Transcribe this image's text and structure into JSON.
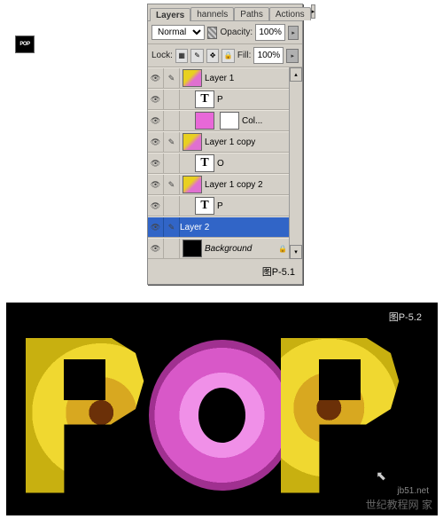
{
  "tabs": {
    "layers": "Layers",
    "channels": "hannels",
    "paths": "Paths",
    "actions": "Actions"
  },
  "blend": {
    "mode": "Normal",
    "opacity_label": "Opacity:",
    "opacity": "100%"
  },
  "lock": {
    "label": "Lock:",
    "fill_label": "Fill:",
    "fill": "100%"
  },
  "layers": {
    "l0": {
      "name": "Layer 1",
      "type": "P"
    },
    "l1": {
      "name": "P"
    },
    "l2": {
      "name": "Col..."
    },
    "l3": {
      "name": "Layer 1 copy",
      "type": "O"
    },
    "l4": {
      "name": "O"
    },
    "l5": {
      "name": "Layer 1 copy 2",
      "type": "P"
    },
    "l6": {
      "name": "P"
    },
    "l7": {
      "name": "Layer 2"
    },
    "l8": {
      "name": "Background"
    }
  },
  "figure1": "图P-5.1",
  "figure2": "图P-5.2",
  "watermark1": "jb51.net",
  "watermark2": "世纪教程网 家",
  "chart_data": null
}
